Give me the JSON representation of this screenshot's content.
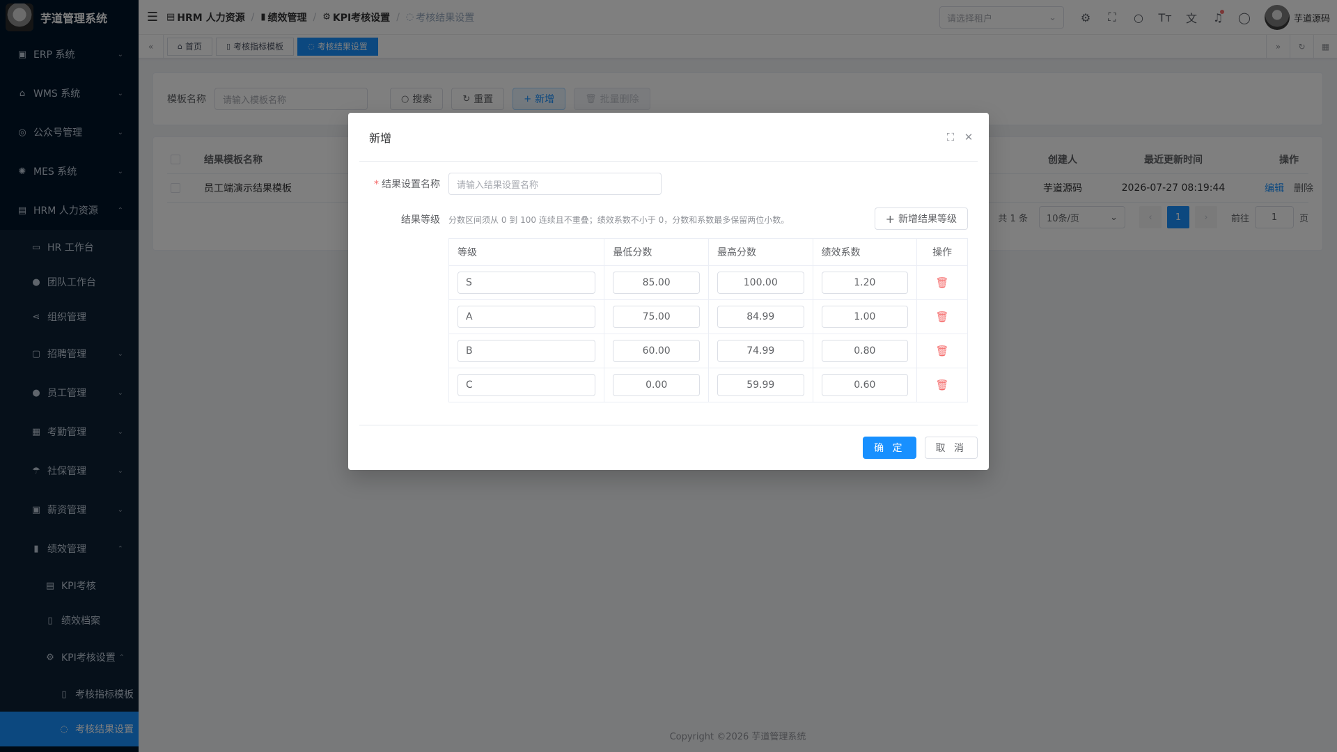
{
  "app": {
    "title": "芋道管理系统"
  },
  "sidebar": {
    "items": [
      {
        "label": "ERP 系统",
        "icon": "erp-icon"
      },
      {
        "label": "WMS 系统",
        "icon": "warehouse-icon"
      },
      {
        "label": "公众号管理",
        "icon": "compass-icon"
      },
      {
        "label": "MES 系统",
        "icon": "cpu-icon"
      },
      {
        "label": "HRM 人力资源",
        "icon": "building-icon"
      },
      {
        "label": "HR 工作台",
        "icon": "monitor-icon"
      },
      {
        "label": "团队工作台",
        "icon": "user-icon"
      },
      {
        "label": "组织管理",
        "icon": "share-icon"
      },
      {
        "label": "招聘管理",
        "icon": "briefcase-icon"
      },
      {
        "label": "员工管理",
        "icon": "user-icon"
      },
      {
        "label": "考勤管理",
        "icon": "calendar-icon"
      },
      {
        "label": "社保管理",
        "icon": "umbrella-icon"
      },
      {
        "label": "薪资管理",
        "icon": "money-icon"
      },
      {
        "label": "绩效管理",
        "icon": "bar-chart-icon"
      },
      {
        "label": "KPI考核",
        "icon": "table-icon"
      },
      {
        "label": "绩效档案",
        "icon": "book-icon"
      },
      {
        "label": "KPI考核设置",
        "icon": "gear-icon"
      },
      {
        "label": "考核指标模板",
        "icon": "document-icon"
      },
      {
        "label": "考核结果设置",
        "icon": "medal-icon"
      }
    ]
  },
  "breadcrumb": [
    "HRM 人力资源",
    "绩效管理",
    "KPI考核设置",
    "考核结果设置"
  ],
  "navbar": {
    "tenant_placeholder": "请选择租户",
    "username": "芋道源码"
  },
  "tags": [
    "首页",
    "考核指标模板",
    "考核结果设置"
  ],
  "search": {
    "label": "模板名称",
    "placeholder": "请输入模板名称",
    "search_btn": "搜索",
    "reset_btn": "重置",
    "add_btn": "新增",
    "batch_delete_btn": "批量删除"
  },
  "table": {
    "headers": {
      "name": "结果模板名称",
      "creator": "创建人",
      "time": "最近更新时间",
      "op": "操作"
    },
    "rows": [
      {
        "name": "员工端演示结果模板",
        "creator": "芋道源码",
        "time": "2026-07-27 08:19:44",
        "edit": "编辑",
        "delete": "删除"
      }
    ]
  },
  "pager": {
    "total": "共 1 条",
    "size": "10条/页",
    "current": "1",
    "goto": "前往",
    "goto_value": "1",
    "page": "页"
  },
  "footer": "Copyright ©2026 芋道管理系统",
  "dialog": {
    "title": "新增",
    "name_label": "结果设置名称",
    "name_placeholder": "请输入结果设置名称",
    "level_label": "结果等级",
    "hint": "分数区间须从 0 到 100 连续且不重叠；绩效系数不小于 0，分数和系数最多保留两位小数。",
    "add_level_btn": "新增结果等级",
    "grid_headers": [
      "等级",
      "最低分数",
      "最高分数",
      "绩效系数",
      "操作"
    ],
    "levels": [
      {
        "level": "S",
        "min": "85.00",
        "max": "100.00",
        "coef": "1.20"
      },
      {
        "level": "A",
        "min": "75.00",
        "max": "84.99",
        "coef": "1.00"
      },
      {
        "level": "B",
        "min": "60.00",
        "max": "74.99",
        "coef": "0.80"
      },
      {
        "level": "C",
        "min": "0.00",
        "max": "59.99",
        "coef": "0.60"
      }
    ],
    "confirm": "确 定",
    "cancel": "取 消"
  },
  "colors": {
    "primary": "#1890ff",
    "sidebar_bg": "#001529",
    "danger": "#f56c6c"
  }
}
